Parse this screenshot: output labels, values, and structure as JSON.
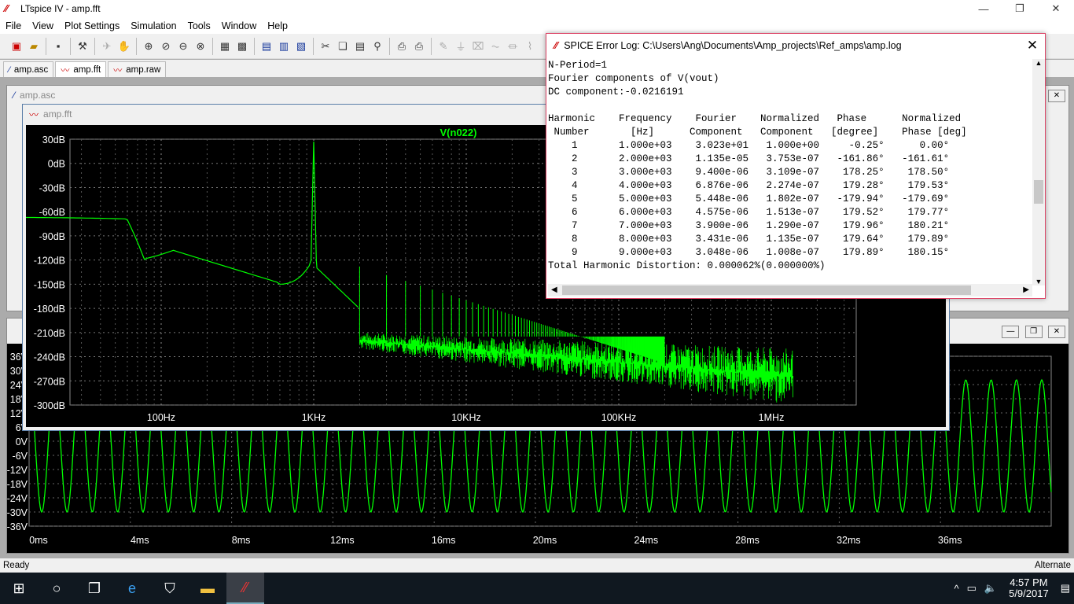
{
  "window": {
    "title": "LTspice IV - amp.fft",
    "minimize": "—",
    "restore": "❐",
    "close": "✕"
  },
  "menu": [
    "File",
    "View",
    "Plot Settings",
    "Simulation",
    "Tools",
    "Window",
    "Help"
  ],
  "tabs": [
    {
      "label": "amp.asc",
      "icon": "schematic-icon"
    },
    {
      "label": "amp.fft",
      "icon": "waveform-icon"
    },
    {
      "label": "amp.raw",
      "icon": "waveform-icon"
    }
  ],
  "schematic_window": {
    "title": "amp.asc"
  },
  "fft_window": {
    "title": "amp.fft",
    "trace_label": "V(n022)",
    "trace_color": "#00ff00",
    "y_ticks": [
      "30dB",
      "0dB",
      "-30dB",
      "-60dB",
      "-90dB",
      "-120dB",
      "-150dB",
      "-180dB",
      "-210dB",
      "-240dB",
      "-270dB",
      "-300dB"
    ],
    "x_ticks": [
      "100Hz",
      "1KHz",
      "10KHz",
      "100KHz",
      "1MHz"
    ]
  },
  "transient_window": {
    "y_ticks": [
      "36V",
      "30V",
      "24V",
      "18V",
      "12V",
      "6V",
      "0V",
      "-6V",
      "-12V",
      "-18V",
      "-24V",
      "-30V",
      "-36V"
    ],
    "x_ticks": [
      "0ms",
      "4ms",
      "8ms",
      "12ms",
      "16ms",
      "20ms",
      "24ms",
      "28ms",
      "32ms",
      "36ms"
    ]
  },
  "error_log": {
    "title": "SPICE Error Log: C:\\Users\\Ang\\Documents\\Amp_projects\\Ref_amps\\amp.log",
    "lines": [
      "N-Period=1",
      "Fourier components of V(vout)",
      "DC component:-0.0216191",
      "",
      "Harmonic    Frequency    Fourier    Normalized   Phase      Normalized",
      " Number       [Hz]      Component   Component   [degree]    Phase [deg]",
      "    1       1.000e+03    3.023e+01   1.000e+00     -0.25°      0.00°",
      "    2       2.000e+03    1.135e-05   3.753e-07   -161.86°   -161.61°",
      "    3       3.000e+03    9.400e-06   3.109e-07    178.25°    178.50°",
      "    4       4.000e+03    6.876e-06   2.274e-07    179.28°    179.53°",
      "    5       5.000e+03    5.448e-06   1.802e-07   -179.94°   -179.69°",
      "    6       6.000e+03    4.575e-06   1.513e-07    179.52°    179.77°",
      "    7       7.000e+03    3.900e-06   1.290e-07    179.96°    180.21°",
      "    8       8.000e+03    3.431e-06   1.135e-07    179.64°    179.89°",
      "    9       9.000e+03    3.048e-06   1.008e-07    179.89°    180.15°",
      "Total Harmonic Distortion: 0.000062%(0.000000%)"
    ]
  },
  "status": {
    "left": "Ready",
    "right": "Alternate"
  },
  "clock": {
    "time": "4:57 PM",
    "date": "5/9/2017"
  }
}
